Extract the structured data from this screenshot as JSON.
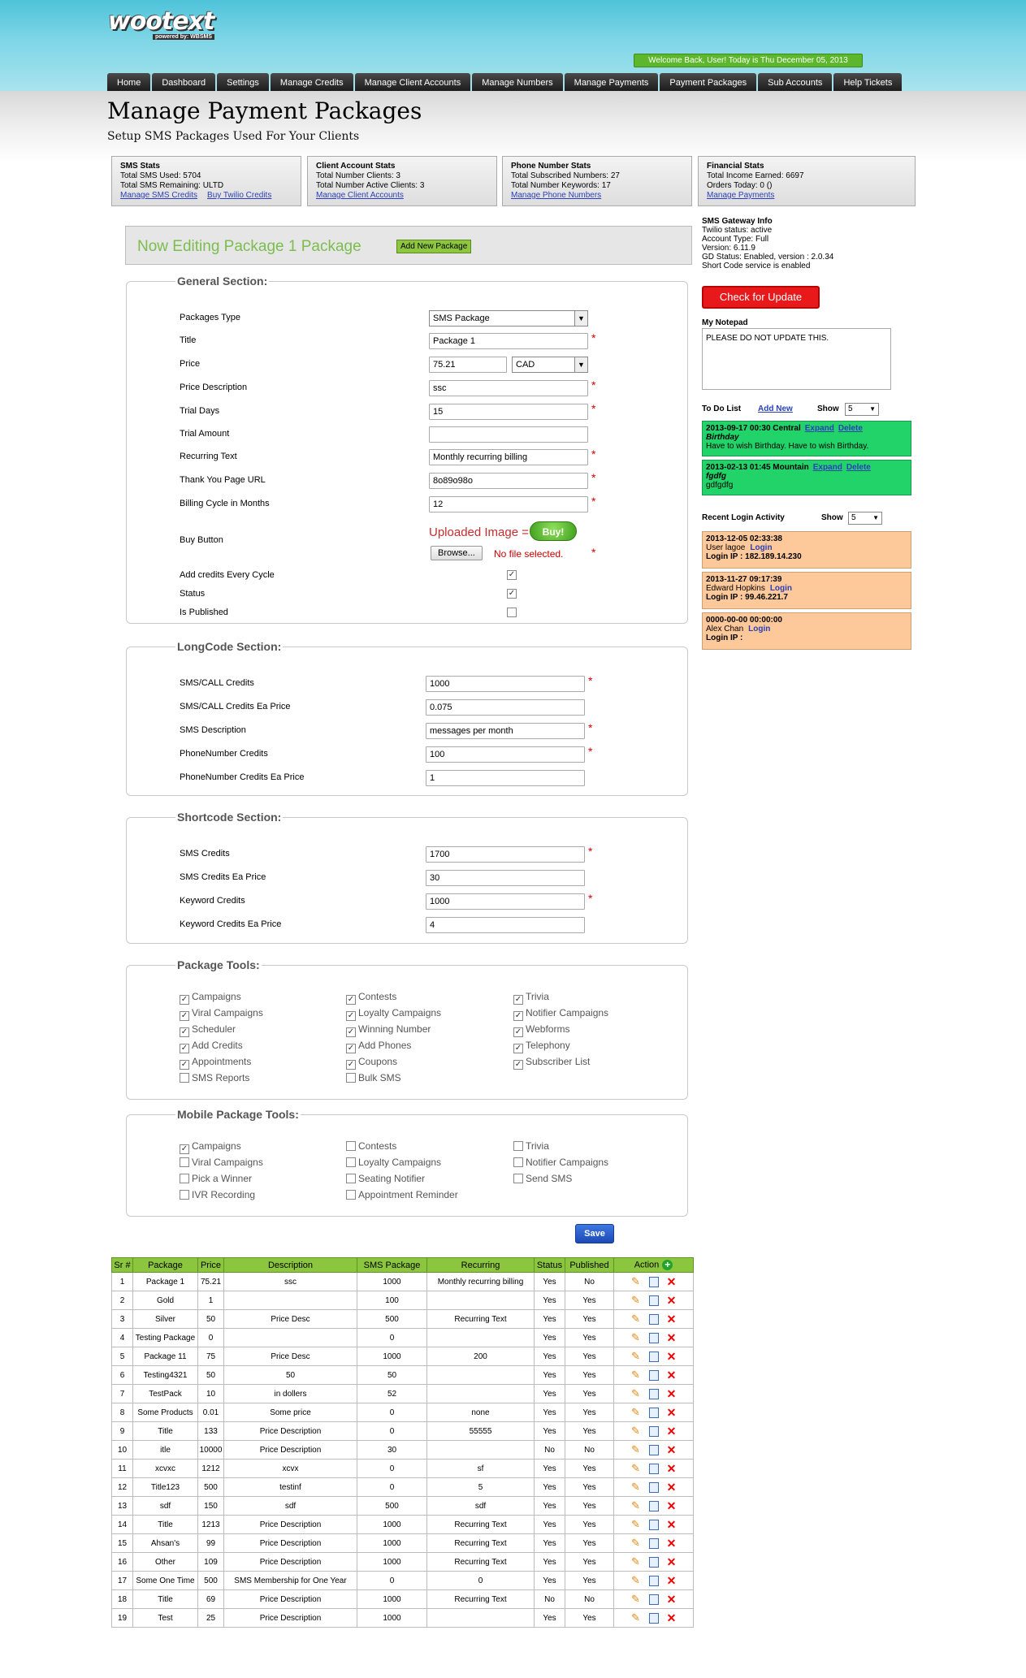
{
  "header": {
    "logo_text": "wootext",
    "logo_tagline": "powered by: WBSMS",
    "welcome": "Welcome Back, User! Today is Thu December 05, 2013",
    "nav": [
      "Home",
      "Dashboard",
      "Settings",
      "Manage Credits",
      "Manage Client Accounts",
      "Manage Numbers",
      "Manage Payments",
      "Payment Packages",
      "Sub Accounts",
      "Help Tickets"
    ]
  },
  "page": {
    "title": "Manage Payment Packages",
    "subtitle": "Setup SMS Packages Used For Your Clients"
  },
  "stats": {
    "sms": {
      "title": "SMS Stats",
      "lines": [
        "Total SMS Used: 5704",
        "Total SMS Remaining: ULTD"
      ],
      "links": [
        "Manage SMS Credits",
        "Buy Twilio Credits"
      ]
    },
    "client": {
      "title": "Client Account Stats",
      "lines": [
        "Total Number Clients: 3",
        "Total Number Active Clients: 3"
      ],
      "links": [
        "Manage Client Accounts"
      ]
    },
    "phone": {
      "title": "Phone Number Stats",
      "lines": [
        "Total Subscribed Numbers: 27",
        "Total Number Keywords: 17"
      ],
      "links": [
        "Manage Phone Numbers"
      ]
    },
    "financial": {
      "title": "Financial Stats",
      "lines": [
        "Total Income Earned: 6697",
        "Orders Today: 0 ()"
      ],
      "links": [
        "Manage Payments"
      ]
    }
  },
  "editing": {
    "title": "Now Editing Package 1 Package",
    "add_new": "Add New Package"
  },
  "general": {
    "legend": "General Section:",
    "packages_type_label": "Packages Type",
    "packages_type_value": "SMS Package",
    "title_label": "Title",
    "title_value": "Package 1",
    "price_label": "Price",
    "price_value": "75.21",
    "currency": "CAD",
    "price_desc_label": "Price Description",
    "price_desc_value": "ssc",
    "trial_days_label": "Trial Days",
    "trial_days_value": "15",
    "trial_amount_label": "Trial Amount",
    "trial_amount_value": "",
    "recurring_label": "Recurring Text",
    "recurring_value": "Monthly recurring billing",
    "thankyou_label": "Thank You Page URL",
    "thankyou_value": "8o89o98o",
    "billing_label": "Billing Cycle in Months",
    "billing_value": "12",
    "buy_label": "Buy Button",
    "uploaded": "Uploaded Image =",
    "buy": "Buy!",
    "browse": "Browse...",
    "nofile": "No file selected.",
    "add_credits_label": "Add credits Every Cycle",
    "add_credits_checked": true,
    "status_label": "Status",
    "status_checked": true,
    "published_label": "Is Published",
    "published_checked": false
  },
  "longcode": {
    "legend": "LongCode Section:",
    "fields": [
      {
        "label": "SMS/CALL Credits",
        "value": "1000",
        "required": true
      },
      {
        "label": "SMS/CALL Credits Ea Price",
        "value": "0.075",
        "required": false
      },
      {
        "label": "SMS Description",
        "value": "messages per month",
        "required": true
      },
      {
        "label": "PhoneNumber Credits",
        "value": "100",
        "required": true
      },
      {
        "label": "PhoneNumber Credits Ea Price",
        "value": "1",
        "required": false
      }
    ]
  },
  "shortcode": {
    "legend": "Shortcode Section:",
    "fields": [
      {
        "label": "SMS Credits",
        "value": "1700",
        "required": true
      },
      {
        "label": "SMS Credits Ea Price",
        "value": "30",
        "required": false
      },
      {
        "label": "Keyword Credits",
        "value": "1000",
        "required": true
      },
      {
        "label": "Keyword Credits Ea Price",
        "value": "4",
        "required": false
      }
    ]
  },
  "package_tools": {
    "legend": "Package Tools:",
    "items": [
      {
        "label": "Campaigns",
        "checked": true
      },
      {
        "label": "Contests",
        "checked": true
      },
      {
        "label": "Trivia",
        "checked": true
      },
      {
        "label": "Viral Campaigns",
        "checked": true
      },
      {
        "label": "Loyalty Campaigns",
        "checked": true
      },
      {
        "label": "Notifier Campaigns",
        "checked": true
      },
      {
        "label": "Scheduler",
        "checked": true
      },
      {
        "label": "Winning Number",
        "checked": true
      },
      {
        "label": "Webforms",
        "checked": true
      },
      {
        "label": "Add Credits",
        "checked": true
      },
      {
        "label": "Add Phones",
        "checked": true
      },
      {
        "label": "Telephony",
        "checked": true
      },
      {
        "label": "Appointments",
        "checked": true
      },
      {
        "label": "Coupons",
        "checked": true
      },
      {
        "label": "Subscriber List",
        "checked": true
      },
      {
        "label": "SMS Reports",
        "checked": false
      },
      {
        "label": "Bulk SMS",
        "checked": false
      }
    ]
  },
  "mobile_tools": {
    "legend": "Mobile Package Tools:",
    "items": [
      {
        "label": "Campaigns",
        "checked": true
      },
      {
        "label": "Contests",
        "checked": false
      },
      {
        "label": "Trivia",
        "checked": false
      },
      {
        "label": "Viral Campaigns",
        "checked": false
      },
      {
        "label": "Loyalty Campaigns",
        "checked": false
      },
      {
        "label": "Notifier Campaigns",
        "checked": false
      },
      {
        "label": "Pick a Winner",
        "checked": false
      },
      {
        "label": "Seating Notifier",
        "checked": false
      },
      {
        "label": "Send SMS",
        "checked": false
      },
      {
        "label": "IVR Recording",
        "checked": false
      },
      {
        "label": "Appointment Reminder",
        "checked": false
      }
    ]
  },
  "save": "Save",
  "sidebar": {
    "gateway_title": "SMS Gateway Info",
    "gateway_lines": [
      "Twilio status: active",
      "Account Type: Full",
      "Version: 6.11.9",
      "GD Status: Enabled, version : 2.0.34",
      "Short Code service is enabled"
    ],
    "update_btn": "Check for Update",
    "notepad_title": "My Notepad",
    "notepad_text": "PLEASE DO NOT UPDATE THIS.",
    "todo_title": "To Do List",
    "todo_add": "Add New",
    "show_label": "Show",
    "show_value": "5",
    "todos": [
      {
        "head": "2013-09-17 00:30 Central",
        "title": "Birthday",
        "body": "Have to wish Birthday. Have to wish Birthday.",
        "expand": "Expand",
        "delete": "Delete"
      },
      {
        "head": "2013-02-13 01:45 Mountain",
        "title": "fgdfg",
        "body": "gdfgdfg",
        "expand": "Expand",
        "delete": "Delete"
      }
    ],
    "recent_title": "Recent Login Activity",
    "recent_show_label": "Show",
    "recent_show_value": "5",
    "logins": [
      {
        "time": "2013-12-05 02:33:38",
        "user": "User lagoe",
        "link": "Login",
        "ip": "Login IP : 182.189.14.230"
      },
      {
        "time": "2013-11-27 09:17:39",
        "user": "Edward Hopkins",
        "link": "Login",
        "ip": "Login IP : 99.46.221.7"
      },
      {
        "time": "0000-00-00 00:00:00",
        "user": "Alex Chan",
        "link": "Login",
        "ip": "Login IP :"
      }
    ]
  },
  "table": {
    "headers": [
      "Sr #",
      "Package",
      "Price",
      "Description",
      "SMS Package",
      "Recurring",
      "Status",
      "Published",
      "Action"
    ],
    "rows": [
      [
        "1",
        "Package 1",
        "75.21",
        "ssc",
        "1000",
        "Monthly recurring billing",
        "Yes",
        "No"
      ],
      [
        "2",
        "Gold",
        "1",
        "",
        "100",
        "",
        "Yes",
        "Yes"
      ],
      [
        "3",
        "Silver",
        "50",
        "Price Desc",
        "500",
        "Recurring Text",
        "Yes",
        "Yes"
      ],
      [
        "4",
        "Testing Package",
        "0",
        "",
        "0",
        "",
        "Yes",
        "Yes"
      ],
      [
        "5",
        "Package 11",
        "75",
        "Price Desc",
        "1000",
        "200",
        "Yes",
        "Yes"
      ],
      [
        "6",
        "Testing4321",
        "50",
        "50",
        "50",
        "",
        "Yes",
        "Yes"
      ],
      [
        "7",
        "TestPack",
        "10",
        "in dollers",
        "52",
        "",
        "Yes",
        "Yes"
      ],
      [
        "8",
        "Some Products",
        "0.01",
        "Some price",
        "0",
        "none",
        "Yes",
        "Yes"
      ],
      [
        "9",
        "Title",
        "133",
        "Price Description",
        "0",
        "55555",
        "Yes",
        "Yes"
      ],
      [
        "10",
        "itle",
        "10000",
        "Price Description",
        "30",
        "",
        "No",
        "No"
      ],
      [
        "11",
        "xcvxc",
        "1212",
        "xcvx",
        "0",
        "sf",
        "Yes",
        "Yes"
      ],
      [
        "12",
        "Title123",
        "500",
        "testinf",
        "0",
        "5",
        "Yes",
        "Yes"
      ],
      [
        "13",
        "sdf",
        "150",
        "sdf",
        "500",
        "sdf",
        "Yes",
        "Yes"
      ],
      [
        "14",
        "Title",
        "1213",
        "Price Description",
        "1000",
        "Recurring Text",
        "Yes",
        "Yes"
      ],
      [
        "15",
        "Ahsan's",
        "99",
        "Price Description",
        "1000",
        "Recurring Text",
        "Yes",
        "Yes"
      ],
      [
        "16",
        "Other",
        "109",
        "Price Description",
        "1000",
        "Recurring Text",
        "Yes",
        "Yes"
      ],
      [
        "17",
        "Some One Time",
        "500",
        "SMS Membership for One Year",
        "0",
        "0",
        "Yes",
        "Yes"
      ],
      [
        "18",
        "Title",
        "69",
        "Price Description",
        "1000",
        "Recurring Text",
        "No",
        "No"
      ],
      [
        "19",
        "Test",
        "25",
        "Price Description",
        "1000",
        "",
        "Yes",
        "Yes"
      ]
    ]
  }
}
